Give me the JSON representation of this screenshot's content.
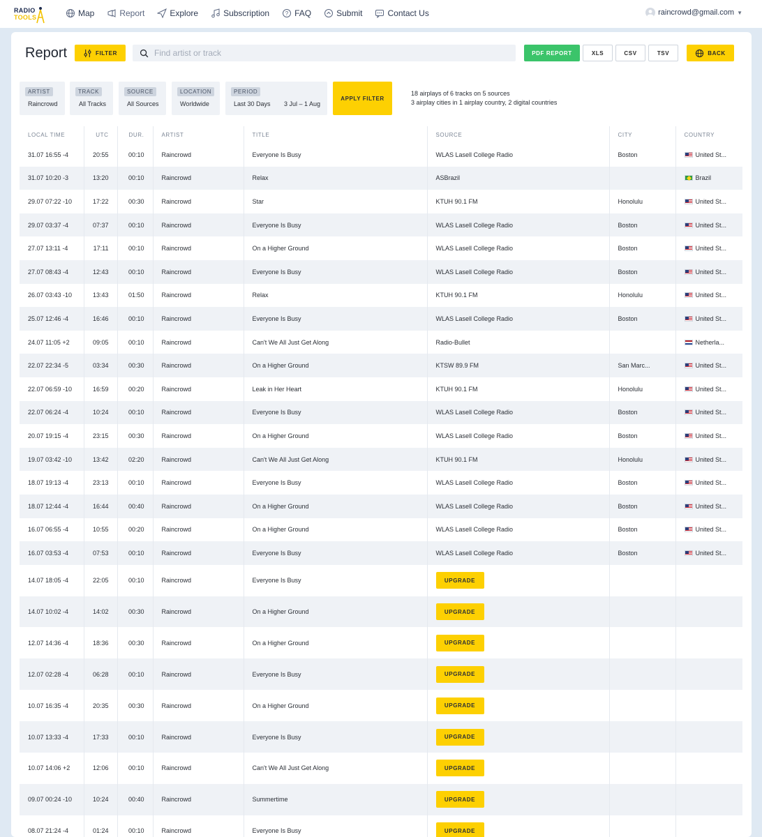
{
  "logo": {
    "line1": "RADIO",
    "line2": "TOOLS"
  },
  "nav": [
    {
      "label": "Map",
      "icon": "globe-icon"
    },
    {
      "label": "Report",
      "icon": "megaphone-icon"
    },
    {
      "label": "Explore",
      "icon": "send-icon"
    },
    {
      "label": "Subscription",
      "icon": "music-note-icon"
    },
    {
      "label": "FAQ",
      "icon": "question-icon"
    },
    {
      "label": "Submit",
      "icon": "upload-icon"
    },
    {
      "label": "Contact Us",
      "icon": "chat-icon"
    }
  ],
  "user": {
    "email": "raincrowd@gmail.com"
  },
  "page": {
    "title": "Report"
  },
  "toolbar": {
    "filter_label": "FILTER",
    "search_placeholder": "Find artist or track",
    "pdf_label": "PDF REPORT",
    "xls_label": "XLS",
    "csv_label": "CSV",
    "tsv_label": "TSV",
    "back_label": "BACK"
  },
  "filters": {
    "artist": {
      "tag": "ARTIST",
      "value": "Raincrowd"
    },
    "track": {
      "tag": "TRACK",
      "value": "All Tracks"
    },
    "source": {
      "tag": "SOURCE",
      "value": "All Sources"
    },
    "location": {
      "tag": "LOCATION",
      "value": "Worldwide"
    },
    "period": {
      "tag": "PERIOD",
      "value": "Last 30 Days",
      "range": "3 Jul – 1 Aug"
    },
    "apply_label": "APPLY FILTER"
  },
  "summary": {
    "line1": "18 airplays of 6 tracks on 5 sources",
    "line2": "3 airplay cities in 1 airplay country, 2 digital countries"
  },
  "table": {
    "headers": [
      "LOCAL TIME",
      "UTC",
      "DUR.",
      "ARTIST",
      "TITLE",
      "SOURCE",
      "CITY",
      "COUNTRY"
    ],
    "rows": [
      {
        "local": "31.07 16:55 -4",
        "utc": "20:55",
        "dur": "00:10",
        "artist": "Raincrowd",
        "title": "Everyone Is Busy",
        "source": "WLAS Lasell College Radio",
        "city": "Boston",
        "country": "United St...",
        "flag": "us"
      },
      {
        "local": "31.07 10:20 -3",
        "utc": "13:20",
        "dur": "00:10",
        "artist": "Raincrowd",
        "title": "Relax",
        "source": "ASBrazil",
        "city": "",
        "country": "Brazil",
        "flag": "br"
      },
      {
        "local": "29.07 07:22 -10",
        "utc": "17:22",
        "dur": "00:30",
        "artist": "Raincrowd",
        "title": "Star",
        "source": "KTUH 90.1 FM",
        "city": "Honolulu",
        "country": "United St...",
        "flag": "us"
      },
      {
        "local": "29.07 03:37 -4",
        "utc": "07:37",
        "dur": "00:10",
        "artist": "Raincrowd",
        "title": "Everyone Is Busy",
        "source": "WLAS Lasell College Radio",
        "city": "Boston",
        "country": "United St...",
        "flag": "us"
      },
      {
        "local": "27.07 13:11 -4",
        "utc": "17:11",
        "dur": "00:10",
        "artist": "Raincrowd",
        "title": "On a Higher Ground",
        "source": "WLAS Lasell College Radio",
        "city": "Boston",
        "country": "United St...",
        "flag": "us"
      },
      {
        "local": "27.07 08:43 -4",
        "utc": "12:43",
        "dur": "00:10",
        "artist": "Raincrowd",
        "title": "Everyone Is Busy",
        "source": "WLAS Lasell College Radio",
        "city": "Boston",
        "country": "United St...",
        "flag": "us"
      },
      {
        "local": "26.07 03:43 -10",
        "utc": "13:43",
        "dur": "01:50",
        "artist": "Raincrowd",
        "title": "Relax",
        "source": "KTUH 90.1 FM",
        "city": "Honolulu",
        "country": "United St...",
        "flag": "us"
      },
      {
        "local": "25.07 12:46 -4",
        "utc": "16:46",
        "dur": "00:10",
        "artist": "Raincrowd",
        "title": "Everyone Is Busy",
        "source": "WLAS Lasell College Radio",
        "city": "Boston",
        "country": "United St...",
        "flag": "us"
      },
      {
        "local": "24.07 11:05 +2",
        "utc": "09:05",
        "dur": "00:10",
        "artist": "Raincrowd",
        "title": "Can't We All Just Get Along",
        "source": "Radio-Bullet",
        "city": "",
        "country": "Netherla...",
        "flag": "nl"
      },
      {
        "local": "22.07 22:34 -5",
        "utc": "03:34",
        "dur": "00:30",
        "artist": "Raincrowd",
        "title": "On a Higher Ground",
        "source": "KTSW 89.9 FM",
        "city": "San Marc...",
        "country": "United St...",
        "flag": "us"
      },
      {
        "local": "22.07 06:59 -10",
        "utc": "16:59",
        "dur": "00:20",
        "artist": "Raincrowd",
        "title": "Leak in Her Heart",
        "source": "KTUH 90.1 FM",
        "city": "Honolulu",
        "country": "United St...",
        "flag": "us"
      },
      {
        "local": "22.07 06:24 -4",
        "utc": "10:24",
        "dur": "00:10",
        "artist": "Raincrowd",
        "title": "Everyone Is Busy",
        "source": "WLAS Lasell College Radio",
        "city": "Boston",
        "country": "United St...",
        "flag": "us"
      },
      {
        "local": "20.07 19:15 -4",
        "utc": "23:15",
        "dur": "00:30",
        "artist": "Raincrowd",
        "title": "On a Higher Ground",
        "source": "WLAS Lasell College Radio",
        "city": "Boston",
        "country": "United St...",
        "flag": "us"
      },
      {
        "local": "19.07 03:42 -10",
        "utc": "13:42",
        "dur": "02:20",
        "artist": "Raincrowd",
        "title": "Can't We All Just Get Along",
        "source": "KTUH 90.1 FM",
        "city": "Honolulu",
        "country": "United St...",
        "flag": "us"
      },
      {
        "local": "18.07 19:13 -4",
        "utc": "23:13",
        "dur": "00:10",
        "artist": "Raincrowd",
        "title": "Everyone Is Busy",
        "source": "WLAS Lasell College Radio",
        "city": "Boston",
        "country": "United St...",
        "flag": "us"
      },
      {
        "local": "18.07 12:44 -4",
        "utc": "16:44",
        "dur": "00:40",
        "artist": "Raincrowd",
        "title": "On a Higher Ground",
        "source": "WLAS Lasell College Radio",
        "city": "Boston",
        "country": "United St...",
        "flag": "us"
      },
      {
        "local": "16.07 06:55 -4",
        "utc": "10:55",
        "dur": "00:20",
        "artist": "Raincrowd",
        "title": "On a Higher Ground",
        "source": "WLAS Lasell College Radio",
        "city": "Boston",
        "country": "United St...",
        "flag": "us"
      },
      {
        "local": "16.07 03:53 -4",
        "utc": "07:53",
        "dur": "00:10",
        "artist": "Raincrowd",
        "title": "Everyone Is Busy",
        "source": "WLAS Lasell College Radio",
        "city": "Boston",
        "country": "United St...",
        "flag": "us"
      },
      {
        "local": "14.07 18:05 -4",
        "utc": "22:05",
        "dur": "00:10",
        "artist": "Raincrowd",
        "title": "Everyone Is Busy",
        "locked": true
      },
      {
        "local": "14.07 10:02 -4",
        "utc": "14:02",
        "dur": "00:30",
        "artist": "Raincrowd",
        "title": "On a Higher Ground",
        "locked": true
      },
      {
        "local": "12.07 14:36 -4",
        "utc": "18:36",
        "dur": "00:30",
        "artist": "Raincrowd",
        "title": "On a Higher Ground",
        "locked": true
      },
      {
        "local": "12.07 02:28 -4",
        "utc": "06:28",
        "dur": "00:10",
        "artist": "Raincrowd",
        "title": "Everyone Is Busy",
        "locked": true
      },
      {
        "local": "10.07 16:35 -4",
        "utc": "20:35",
        "dur": "00:30",
        "artist": "Raincrowd",
        "title": "On a Higher Ground",
        "locked": true
      },
      {
        "local": "10.07 13:33 -4",
        "utc": "17:33",
        "dur": "00:10",
        "artist": "Raincrowd",
        "title": "Everyone Is Busy",
        "locked": true
      },
      {
        "local": "10.07 14:06 +2",
        "utc": "12:06",
        "dur": "00:10",
        "artist": "Raincrowd",
        "title": "Can't We All Just Get Along",
        "locked": true
      },
      {
        "local": "09.07 00:24 -10",
        "utc": "10:24",
        "dur": "00:40",
        "artist": "Raincrowd",
        "title": "Summertime",
        "locked": true
      },
      {
        "local": "08.07 21:24 -4",
        "utc": "01:24",
        "dur": "00:10",
        "artist": "Raincrowd",
        "title": "Everyone Is Busy",
        "locked": true
      }
    ],
    "upgrade_label": "UPGRADE"
  },
  "colors": {
    "accent": "#fdd002",
    "pdf": "#3bc46a",
    "stripe": "#eff2f6"
  }
}
